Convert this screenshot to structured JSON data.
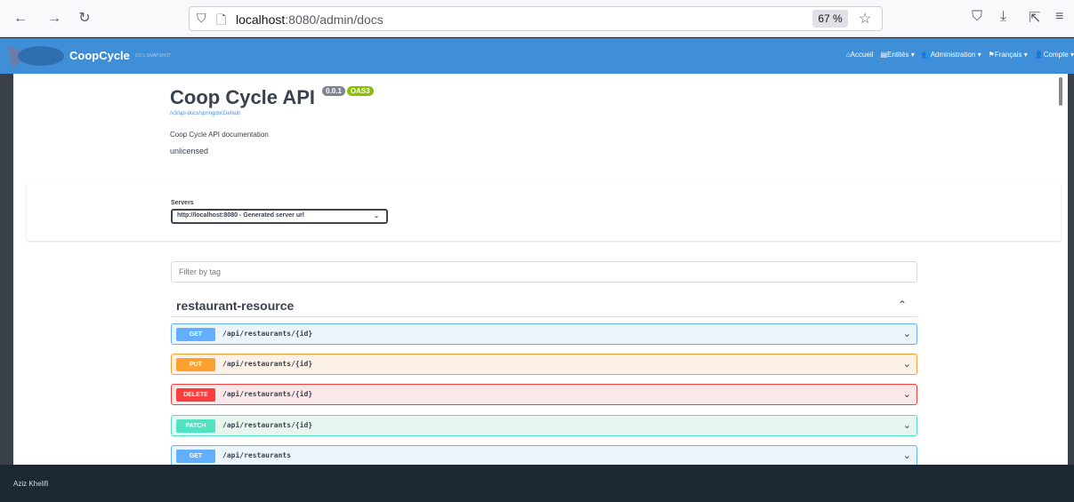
{
  "browser": {
    "url_host": "localhost",
    "url_path": ":8080/admin/docs",
    "zoom": "67 %"
  },
  "navbar": {
    "brand": "CoopCycle",
    "version": "0.0.1-SNAPSHOT",
    "items": [
      "Accueil",
      "Entités",
      "Administration",
      "Français",
      "Compte"
    ]
  },
  "api": {
    "title": "Coop Cycle API",
    "version_badge": "0.0.1",
    "oas_badge": "OAS3",
    "link": "/v3/api-docs/springdocDefault",
    "description": "Coop Cycle API documentation",
    "license": "unlicensed"
  },
  "servers": {
    "label": "Servers",
    "selected": "http://localhost:8080 - Generated server url"
  },
  "filter": {
    "placeholder": "Filter by tag"
  },
  "tag": {
    "name": "restaurant-resource"
  },
  "operations": [
    {
      "method": "GET",
      "path": "/api/restaurants/{id}"
    },
    {
      "method": "PUT",
      "path": "/api/restaurants/{id}"
    },
    {
      "method": "DELETE",
      "path": "/api/restaurants/{id}"
    },
    {
      "method": "PATCH",
      "path": "/api/restaurants/{id}"
    },
    {
      "method": "GET",
      "path": "/api/restaurants"
    }
  ],
  "footer": {
    "author": "Aziz Khelifi"
  }
}
